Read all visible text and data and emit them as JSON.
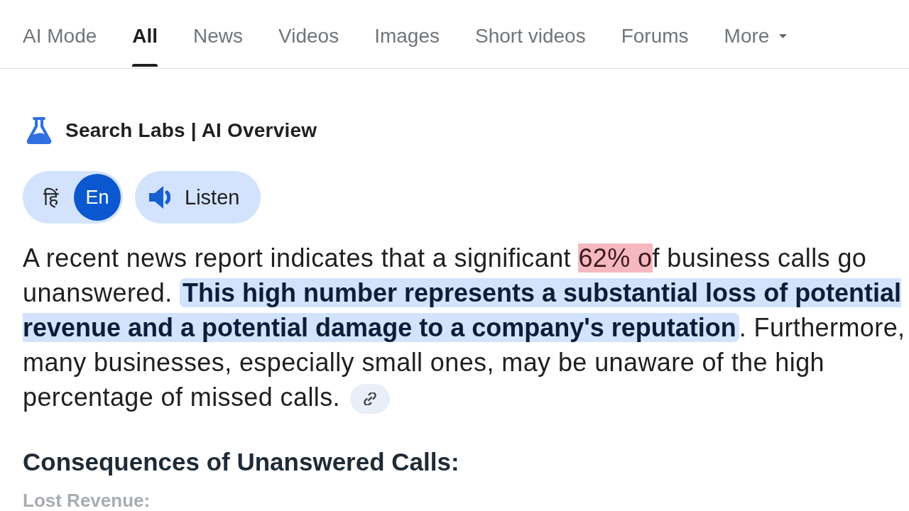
{
  "tabs": [
    {
      "label": "AI Mode",
      "kind": "tab",
      "selected": false
    },
    {
      "label": "All",
      "kind": "tab",
      "selected": true
    },
    {
      "label": "News",
      "kind": "tab",
      "selected": false
    },
    {
      "label": "Videos",
      "kind": "tab",
      "selected": false
    },
    {
      "label": "Images",
      "kind": "tab",
      "selected": false
    },
    {
      "label": "Short videos",
      "kind": "tab",
      "selected": false
    },
    {
      "label": "Forums",
      "kind": "tab",
      "selected": false
    },
    {
      "label": "More",
      "kind": "menu",
      "selected": false
    }
  ],
  "ai_overview": {
    "title": "Search Labs | AI Overview",
    "language_toggle": [
      {
        "label": "हिं",
        "selected": false
      },
      {
        "label": "En",
        "selected": true
      }
    ],
    "listen_button": {
      "label": "Listen"
    },
    "summary": {
      "segments": [
        {
          "kind": "plain",
          "text": "A recent news report indicates that a significant "
        },
        {
          "kind": "marked",
          "text": "62% o"
        },
        {
          "kind": "plain",
          "text": "f business calls go unanswered. "
        },
        {
          "kind": "highlighted",
          "text": "This high number represents a substantial loss of potential revenue and a potential damage to a company's reputation"
        },
        {
          "kind": "plain",
          "text": ". Furthermore, many businesses, especially small ones, may be unaware of the high percentage of missed calls. "
        }
      ]
    },
    "section_heading": "Consequences of Unanswered Calls:",
    "next_item": "Lost Revenue:"
  }
}
